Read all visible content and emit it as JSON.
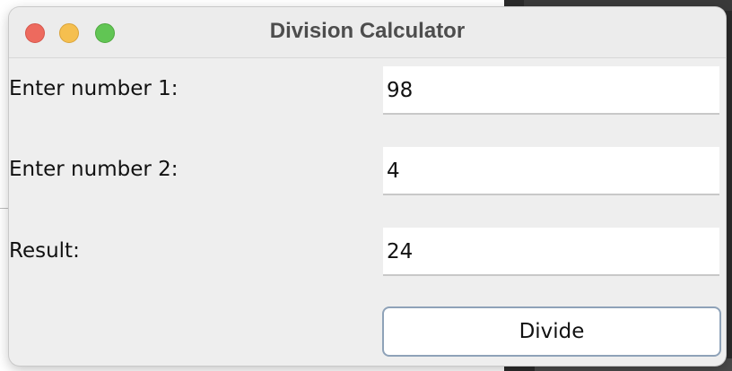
{
  "window": {
    "title": "Division Calculator"
  },
  "form": {
    "number1_label": "Enter number 1:",
    "number1_value": "98",
    "number2_label": "Enter number 2:",
    "number2_value": "4",
    "result_label": "Result:",
    "result_value": "24",
    "divide_label": "Divide"
  },
  "colors": {
    "close": "#ed6a5e",
    "minimize": "#f5bf4f",
    "maximize": "#61c554",
    "button_border": "#8ea2b8"
  },
  "icons": [
    "close-traffic-light-icon",
    "minimize-traffic-light-icon",
    "maximize-traffic-light-icon"
  ]
}
